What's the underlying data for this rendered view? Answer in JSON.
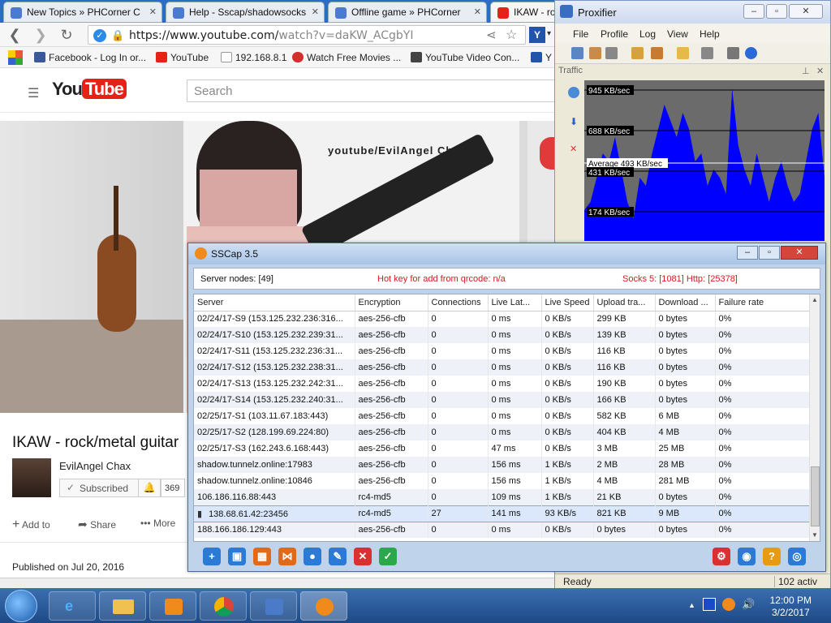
{
  "browser": {
    "tabs": [
      {
        "label": "New Topics » PHCorner C",
        "color": "#4a7bd0"
      },
      {
        "label": "Help - Sscap/shadowsocks",
        "color": "#4a7bd0"
      },
      {
        "label": "Offline game » PHCorner",
        "color": "#4a7bd0"
      },
      {
        "label": "IKAW - roc",
        "color": "#e62117"
      }
    ],
    "url_host": "https://www.youtube.com/",
    "url_path": "watch?v=daKW_ACgbYI",
    "bookmarks": [
      {
        "label": "Facebook - Log In or...",
        "color": "#3b5998"
      },
      {
        "label": "YouTube",
        "color": "#e62117"
      },
      {
        "label": "192.168.8.1",
        "color": "#999999"
      },
      {
        "label": "Watch Free Movies ...",
        "color": "#d32f2f"
      },
      {
        "label": "YouTube Video Con...",
        "color": "#444444"
      },
      {
        "label": "Y",
        "color": "#2255aa"
      }
    ],
    "apps_icon": "apps-grid-icon"
  },
  "youtube": {
    "logo_you": "You",
    "logo_tube": "Tube",
    "search_placeholder": "Search",
    "video_overlay": "youtube/EvilAngel Chax",
    "video_title": "IKAW - rock/metal guitar",
    "channel": "EvilAngel Chax",
    "subscribed": "Subscribed",
    "sub_count": "369",
    "add_to": "Add to",
    "share": "Share",
    "more": "More",
    "published": "Published on Jul 20, 2016"
  },
  "proxifier": {
    "title": "Proxifier",
    "menu": [
      "File",
      "Profile",
      "Log",
      "View",
      "Help"
    ],
    "traffic_label": "Traffic",
    "levels": [
      {
        "label": "945 KB/sec",
        "value": 945
      },
      {
        "label": "688 KB/sec",
        "value": 688
      },
      {
        "label": "431 KB/sec",
        "value": 431
      },
      {
        "label": "174 KB/sec",
        "value": 174
      }
    ],
    "average_label": "Average 493 KB/sec",
    "average_value": 493,
    "status": "Ready",
    "active": "102 activ"
  },
  "sscap": {
    "title": "SSCap 3.5",
    "server_nodes": "Server nodes: [49]",
    "hotkey": "Hot key for add from qrcode: n/a",
    "socks": "Socks 5: [1081] Http: [25378]",
    "columns": [
      "Server",
      "Encryption",
      "Connections",
      "Live Lat...",
      "Live Speed",
      "Upload tra...",
      "Download ...",
      "Failure rate"
    ],
    "rows": [
      [
        "02/24/17-S9 (153.125.232.236:316...",
        "aes-256-cfb",
        "0",
        "0 ms",
        "0 KB/s",
        "299 KB",
        "0 bytes",
        "0%"
      ],
      [
        "02/24/17-S10 (153.125.232.239:31...",
        "aes-256-cfb",
        "0",
        "0 ms",
        "0 KB/s",
        "139 KB",
        "0 bytes",
        "0%"
      ],
      [
        "02/24/17-S11 (153.125.232.236:31...",
        "aes-256-cfb",
        "0",
        "0 ms",
        "0 KB/s",
        "116 KB",
        "0 bytes",
        "0%"
      ],
      [
        "02/24/17-S12 (153.125.232.238:31...",
        "aes-256-cfb",
        "0",
        "0 ms",
        "0 KB/s",
        "116 KB",
        "0 bytes",
        "0%"
      ],
      [
        "02/24/17-S13 (153.125.232.242:31...",
        "aes-256-cfb",
        "0",
        "0 ms",
        "0 KB/s",
        "190 KB",
        "0 bytes",
        "0%"
      ],
      [
        "02/24/17-S14 (153.125.232.240:31...",
        "aes-256-cfb",
        "0",
        "0 ms",
        "0 KB/s",
        "166 KB",
        "0 bytes",
        "0%"
      ],
      [
        "02/25/17-S1 (103.11.67.183:443)",
        "aes-256-cfb",
        "0",
        "0 ms",
        "0 KB/s",
        "582 KB",
        "6 MB",
        "0%"
      ],
      [
        "02/25/17-S2 (128.199.69.224:80)",
        "aes-256-cfb",
        "0",
        "0 ms",
        "0 KB/s",
        "404 KB",
        "4 MB",
        "0%"
      ],
      [
        "02/25/17-S3 (162.243.6.168:443)",
        "aes-256-cfb",
        "0",
        "47 ms",
        "0 KB/s",
        "3 MB",
        "25 MB",
        "0%"
      ],
      [
        "shadow.tunnelz.online:17983",
        "aes-256-cfb",
        "0",
        "156 ms",
        "1 KB/s",
        "2 MB",
        "28 MB",
        "0%"
      ],
      [
        "shadow.tunnelz.online:10846",
        "aes-256-cfb",
        "0",
        "156 ms",
        "1 KB/s",
        "4 MB",
        "281 MB",
        "0%"
      ],
      [
        "106.186.116.88:443",
        "rc4-md5",
        "0",
        "109 ms",
        "1 KB/s",
        "21 KB",
        "0 bytes",
        "0%"
      ],
      [
        "138.68.61.42:23456",
        "rc4-md5",
        "27",
        "141 ms",
        "93 KB/s",
        "821 KB",
        "9 MB",
        "0%"
      ],
      [
        "188.166.186.129:443",
        "aes-256-cfb",
        "0",
        "0 ms",
        "0 KB/s",
        "0 bytes",
        "0 bytes",
        "0%"
      ]
    ],
    "selected_row": 12,
    "toolbar_left": [
      {
        "name": "add-server-icon",
        "glyph": "+",
        "color": "#2a7ad6"
      },
      {
        "name": "qrcode-icon",
        "glyph": "▣",
        "color": "#2a7ad6"
      },
      {
        "name": "grid-icon",
        "glyph": "▦",
        "color": "#e06a1a"
      },
      {
        "name": "share-icon",
        "glyph": "⋈",
        "color": "#e06a1a"
      },
      {
        "name": "lightbulb-icon",
        "glyph": "●",
        "color": "#2a7ad6"
      },
      {
        "name": "edit-icon",
        "glyph": "✎",
        "color": "#2a7ad6"
      },
      {
        "name": "delete-icon",
        "glyph": "✕",
        "color": "#d93030"
      },
      {
        "name": "check-icon",
        "glyph": "✓",
        "color": "#2aa84a"
      }
    ],
    "toolbar_right": [
      {
        "name": "settings-icon",
        "glyph": "⚙",
        "color": "#d93030"
      },
      {
        "name": "globe-icon",
        "glyph": "◉",
        "color": "#2a7ad6"
      },
      {
        "name": "help-icon",
        "glyph": "?",
        "color": "#e89a12"
      },
      {
        "name": "network-icon",
        "glyph": "◎",
        "color": "#2a7ad6"
      }
    ]
  },
  "taskbar": {
    "time": "12:00 PM",
    "date": "3/2/2017"
  }
}
